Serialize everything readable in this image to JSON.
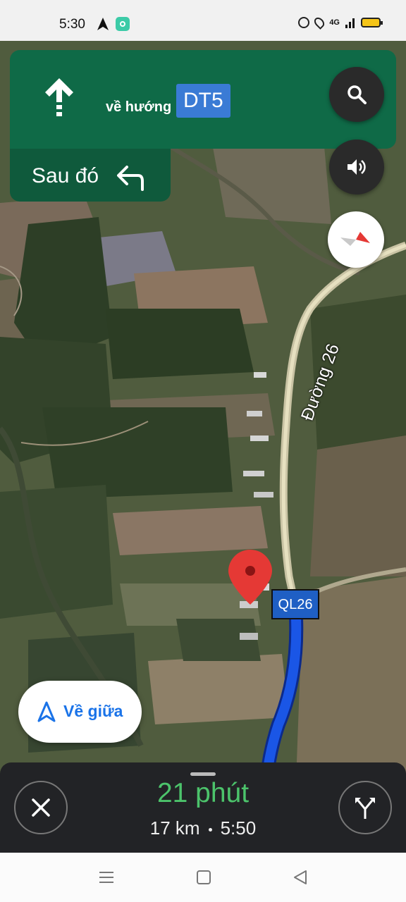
{
  "status_bar": {
    "time": "5:30",
    "network": "4G",
    "icons": [
      "navigation-arrow-icon",
      "app-notification-icon",
      "alarm-icon",
      "location-icon",
      "signal-icon",
      "battery-icon"
    ]
  },
  "navigation": {
    "direction_icon": "straight-arrow-icon",
    "towards_text": "về hướng",
    "road": "DT5",
    "then_label": "Sau đó",
    "then_icon": "turn-left-arrow-icon",
    "banner_color": "#0f6a47"
  },
  "map": {
    "road_name": "Đường 26",
    "route_badge": "QL26",
    "route_color": "#1a56e6"
  },
  "controls": {
    "search_icon": "search-icon",
    "sound_icon": "volume-icon",
    "compass_icon": "compass-icon",
    "recenter_label": "Về giữa"
  },
  "trip": {
    "duration": "21 phút",
    "distance": "17 km",
    "arrival": "5:50",
    "duration_color": "#4cc36b",
    "close_icon": "close-icon",
    "routes_icon": "alternate-routes-icon"
  },
  "system_nav": {
    "icons": [
      "menu-icon",
      "home-icon",
      "back-icon"
    ]
  }
}
